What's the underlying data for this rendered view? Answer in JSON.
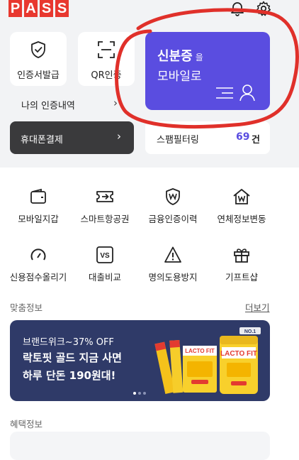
{
  "header": {
    "logo_letters": [
      "P",
      "A",
      "S",
      "S"
    ],
    "icons": [
      "bell-icon",
      "gear-icon"
    ]
  },
  "quick": {
    "cert_issue_label": "인증서발급",
    "qr_label": "QR인증",
    "history_label": "나의 인증내역",
    "history_chevron": "›",
    "pay_label": "휴대폰결제",
    "pay_chevron": "›"
  },
  "id_card": {
    "title": "신분증",
    "particle": "을",
    "subtitle": "모바일로",
    "color": "#5a4de0"
  },
  "spam": {
    "label": "스팸필터링",
    "count": "69",
    "unit": "건"
  },
  "services": [
    {
      "label": "모바일지갑",
      "icon": "wallet-icon"
    },
    {
      "label": "스마트항공권",
      "icon": "airplane-ticket-icon"
    },
    {
      "label": "금융인증이력",
      "icon": "shield-won-icon"
    },
    {
      "label": "연체정보변동",
      "icon": "house-won-icon"
    },
    {
      "label": "신용점수올리기",
      "icon": "gauge-icon"
    },
    {
      "label": "대출비교",
      "icon": "vs-icon"
    },
    {
      "label": "명의도용방지",
      "icon": "warning-icon"
    },
    {
      "label": "기프트샵",
      "icon": "gift-icon"
    }
  ],
  "recommend": {
    "title": "맞춤정보",
    "more": "더보기",
    "banner": {
      "line1": "브랜드위크~37% OFF",
      "line2": "락토핏 골드 지금 사면",
      "line3": "하루 단돈 190원대!",
      "product_text": "LACTO FIT",
      "badge_text": "NO.1"
    }
  },
  "benefit": {
    "title": "혜택정보"
  },
  "colors": {
    "brand_red": "#e8382f",
    "accent_purple": "#5a4de0",
    "annotation_red": "#e0302a"
  }
}
